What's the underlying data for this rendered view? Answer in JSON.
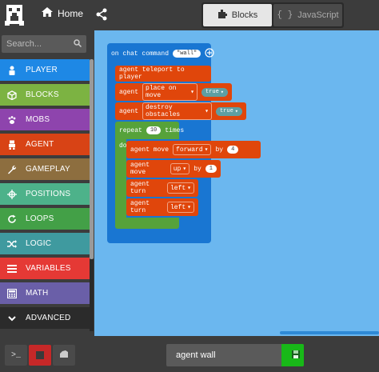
{
  "topbar": {
    "home_label": "Home",
    "tabs": [
      {
        "label": "Blocks",
        "icon": "puzzle-icon",
        "active": true
      },
      {
        "label": "JavaScript",
        "icon": "braces-icon",
        "active": false
      }
    ]
  },
  "sidebar": {
    "search_placeholder": "Search...",
    "categories": [
      {
        "label": "PLAYER",
        "color": "#1e88e5",
        "icon": "person-icon"
      },
      {
        "label": "BLOCKS",
        "color": "#7cb342",
        "icon": "cube-icon"
      },
      {
        "label": "MOBS",
        "color": "#8e44ad",
        "icon": "paw-icon"
      },
      {
        "label": "AGENT",
        "color": "#d84315",
        "icon": "robot-icon"
      },
      {
        "label": "GAMEPLAY",
        "color": "#8d6e3f",
        "icon": "wrench-icon"
      },
      {
        "label": "POSITIONS",
        "color": "#4db28a",
        "icon": "crosshair-icon"
      },
      {
        "label": "LOOPS",
        "color": "#43a047",
        "icon": "loop-icon"
      },
      {
        "label": "LOGIC",
        "color": "#3f9a9f",
        "icon": "shuffle-icon"
      },
      {
        "label": "VARIABLES",
        "color": "#e53935",
        "icon": "list-icon"
      },
      {
        "label": "MATH",
        "color": "#6a5fa8",
        "icon": "calculator-icon"
      },
      {
        "label": "ADVANCED",
        "color": "#2b2b2b",
        "icon": "chevron-down-icon"
      }
    ]
  },
  "workspace": {
    "event": {
      "text": "on chat command",
      "arg": "\"wall\""
    },
    "teleport": {
      "text": "agent teleport to player"
    },
    "place": {
      "text": "agent",
      "dd": "place on move",
      "val": "true"
    },
    "destroy": {
      "text": "agent",
      "dd": "destroy obstacles",
      "val": "true"
    },
    "repeat": {
      "text": "repeat",
      "count": "10",
      "suffix": "times",
      "do": "do"
    },
    "move1": {
      "text": "agent move",
      "dd": "forward",
      "by": "by",
      "num": "4"
    },
    "move2": {
      "text": "agent move",
      "dd": "up",
      "by": "by",
      "num": "1"
    },
    "turn1": {
      "text": "agent turn",
      "dd": "left"
    },
    "turn2": {
      "text": "agent turn",
      "dd": "left"
    }
  },
  "bottombar": {
    "project_name": "agent wall"
  }
}
